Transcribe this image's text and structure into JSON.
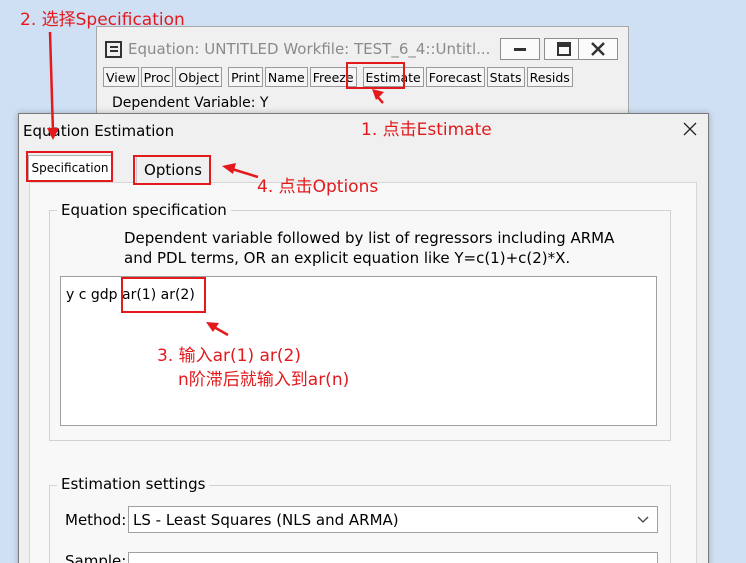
{
  "background_window": {
    "title": "Equation: UNTITLED   Workfile: TEST_6_4::Untitl...",
    "toolbar": [
      "View",
      "Proc",
      "Object",
      "Print",
      "Name",
      "Freeze",
      "Estimate",
      "Forecast",
      "Stats",
      "Resids"
    ],
    "dependent_variable": "Dependent Variable: Y"
  },
  "dialog": {
    "title": "Equation Estimation",
    "tabs": [
      "Specification",
      "Options"
    ],
    "equation_group": {
      "label": "Equation specification",
      "description_line1": "Dependent variable followed by list of regressors including ARMA",
      "description_line2": "and PDL terms, OR an explicit equation like Y=c(1)+c(2)*X.",
      "equation_prefix": "y c gdp",
      "equation_ar": "ar(1) ar(2)"
    },
    "settings_group": {
      "label": "Estimation settings",
      "method_label": "Method:",
      "method_value": "LS  -  Least Squares (NLS and ARMA)",
      "sample_label": "Sample:"
    }
  },
  "annotations": {
    "step1": "1. 点击Estimate",
    "step2": "2. 选择Specification",
    "step3_line1": "3. 输入ar(1) ar(2)",
    "step3_line2": "n阶滞后就输入到ar(n)",
    "step4": "4. 点击Options",
    "color": "#e3191c"
  }
}
